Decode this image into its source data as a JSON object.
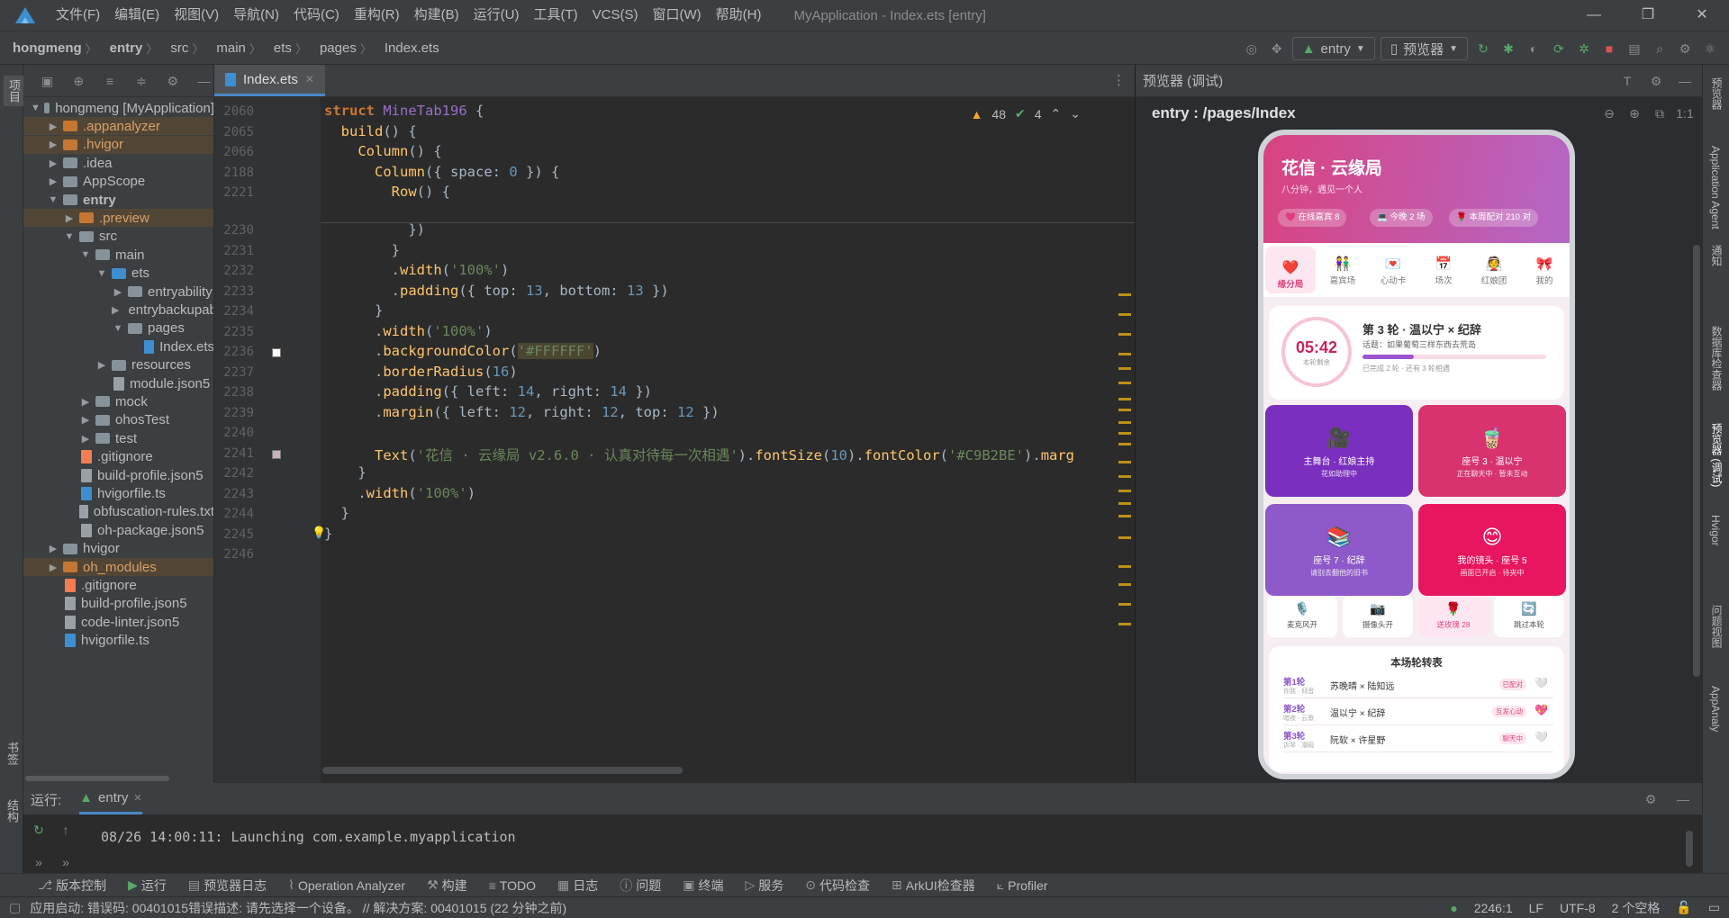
{
  "menu": [
    "文件(F)",
    "编辑(E)",
    "视图(V)",
    "导航(N)",
    "代码(C)",
    "重构(R)",
    "构建(B)",
    "运行(U)",
    "工具(T)",
    "VCS(S)",
    "窗口(W)",
    "帮助(H)"
  ],
  "window_title": "MyApplication - Index.ets [entry]",
  "breadcrumb": [
    "hongmeng",
    "entry",
    "src",
    "main",
    "ets",
    "pages",
    "Index.ets"
  ],
  "run_config": "entry",
  "device_combo": "预览器",
  "left_tabs": [
    "项目",
    "书签",
    "结构"
  ],
  "tree": [
    {
      "label": "hongmeng [MyApplication]",
      "depth": 0,
      "open": true,
      "kind": "fold-b"
    },
    {
      "label": ".appanalyzer",
      "depth": 1,
      "kind": "fold-o",
      "closed": true,
      "hl": true
    },
    {
      "label": ".hvigor",
      "depth": 1,
      "kind": "fold-o",
      "closed": true,
      "hl": true
    },
    {
      "label": ".idea",
      "depth": 1,
      "kind": "fold-b",
      "closed": true
    },
    {
      "label": "AppScope",
      "depth": 1,
      "kind": "fold-b",
      "closed": true
    },
    {
      "label": "entry",
      "depth": 1,
      "kind": "fold-b",
      "open": true,
      "bold": true
    },
    {
      "label": ".preview",
      "depth": 2,
      "kind": "fold-o",
      "closed": true,
      "hl": true
    },
    {
      "label": "src",
      "depth": 2,
      "kind": "fold-b",
      "open": true
    },
    {
      "label": "main",
      "depth": 3,
      "kind": "fold-b",
      "open": true
    },
    {
      "label": "ets",
      "depth": 4,
      "kind": "fold-bl",
      "open": true
    },
    {
      "label": "entryability",
      "depth": 5,
      "kind": "fold-b",
      "closed": true
    },
    {
      "label": "entrybackupability",
      "depth": 5,
      "kind": "fold-b",
      "closed": true
    },
    {
      "label": "pages",
      "depth": 5,
      "kind": "fold-b",
      "open": true
    },
    {
      "label": "Index.ets",
      "depth": 6,
      "kind": "file-ts"
    },
    {
      "label": "resources",
      "depth": 4,
      "kind": "fold-b",
      "closed": true
    },
    {
      "label": "module.json5",
      "depth": 4,
      "kind": "file"
    },
    {
      "label": "mock",
      "depth": 3,
      "kind": "fold-b",
      "closed": true
    },
    {
      "label": "ohosTest",
      "depth": 3,
      "kind": "fold-b",
      "closed": true
    },
    {
      "label": "test",
      "depth": 3,
      "kind": "fold-b",
      "closed": true
    },
    {
      "label": ".gitignore",
      "depth": 2,
      "kind": "file-gi"
    },
    {
      "label": "build-profile.json5",
      "depth": 2,
      "kind": "file"
    },
    {
      "label": "hvigorfile.ts",
      "depth": 2,
      "kind": "file-ts"
    },
    {
      "label": "obfuscation-rules.txt",
      "depth": 2,
      "kind": "file"
    },
    {
      "label": "oh-package.json5",
      "depth": 2,
      "kind": "file"
    },
    {
      "label": "hvigor",
      "depth": 1,
      "kind": "fold-b",
      "closed": true
    },
    {
      "label": "oh_modules",
      "depth": 1,
      "kind": "fold-o",
      "closed": true,
      "hl": true
    },
    {
      "label": ".gitignore",
      "depth": 1,
      "kind": "file-gi"
    },
    {
      "label": "build-profile.json5",
      "depth": 1,
      "kind": "file"
    },
    {
      "label": "code-linter.json5",
      "depth": 1,
      "kind": "file"
    },
    {
      "label": "hvigorfile.ts",
      "depth": 1,
      "kind": "file-ts"
    }
  ],
  "editor_tab": "Index.ets",
  "inspections": {
    "warnings": "48",
    "ok": "4"
  },
  "sticky_lines": [
    {
      "n": "2060",
      "html": "<span class='kw'>struct</span> <span class='cls'>MineTab196</span> {"
    },
    {
      "n": "2065",
      "html": "  <span class='fn'>build</span>() {"
    },
    {
      "n": "2066",
      "html": "    <span class='fn'>Column</span>() {"
    },
    {
      "n": "2188",
      "html": "      <span class='fn'>Column</span>({ space: <span class='num'>0</span> }) {"
    },
    {
      "n": "2221",
      "html": "        <span class='fn'>Row</span>() {"
    }
  ],
  "code_lines": [
    {
      "n": "2230",
      "html": "          })"
    },
    {
      "n": "2231",
      "html": "        }"
    },
    {
      "n": "2232",
      "html": "        .<span class='fn'>width</span>(<span class='str'>'100%'</span>)"
    },
    {
      "n": "2233",
      "html": "        .<span class='fn'>padding</span>({ top: <span class='num'>13</span>, bottom: <span class='num'>13</span> })"
    },
    {
      "n": "2234",
      "html": "      }"
    },
    {
      "n": "2235",
      "html": "      .<span class='fn'>width</span>(<span class='str'>'100%'</span>)"
    },
    {
      "n": "2236",
      "html": "      .<span class='fn'>backgroundColor</span>(<span class='str' style='background:#4b4632'>'#FFFFFF'</span>)"
    },
    {
      "n": "2237",
      "html": "      .<span class='fn'>borderRadius</span>(<span class='num'>16</span>)"
    },
    {
      "n": "2238",
      "html": "      .<span class='fn'>padding</span>({ left: <span class='num'>14</span>, right: <span class='num'>14</span> })"
    },
    {
      "n": "2239",
      "html": "      .<span class='fn'>margin</span>({ left: <span class='num'>12</span>, right: <span class='num'>12</span>, top: <span class='num'>12</span> })"
    },
    {
      "n": "2240",
      "html": ""
    },
    {
      "n": "2241",
      "html": "      <span class='fn'>Text</span>(<span class='str'>'花信 · 云缘局 v2.6.0 · 认真对待每一次相遇'</span>).<span class='fn'>fontSize</span>(<span class='num'>10</span>).<span class='fn'>fontColor</span>(<span class='str'>'#C9B2BE'</span>).<span class='fn'>marg</span>"
    },
    {
      "n": "2242",
      "html": "    }"
    },
    {
      "n": "2243",
      "html": "    .<span class='fn'>width</span>(<span class='str'>'100%'</span>)"
    },
    {
      "n": "2244",
      "html": "  }"
    },
    {
      "n": "2245",
      "html": "}"
    },
    {
      "n": "2246",
      "html": ""
    }
  ],
  "preview": {
    "title": "预览器 (调试)",
    "route": "entry : /pages/Index"
  },
  "phone": {
    "title": "花信 · 云缘局",
    "subtitle": "八分钟，遇见一个人",
    "chips": [
      "在线嘉宾 8",
      "今晚 2 场",
      "本周配对 210 对"
    ],
    "nav": [
      {
        "e": "❤️",
        "t": "缘分局",
        "on": true
      },
      {
        "e": "👫",
        "t": "嘉宾场"
      },
      {
        "e": "💌",
        "t": "心动卡"
      },
      {
        "e": "📅",
        "t": "场次"
      },
      {
        "e": "👰",
        "t": "红娘团"
      },
      {
        "e": "🎀",
        "t": "我的"
      }
    ],
    "timer": "05:42",
    "timer_label": "本轮剩余",
    "round_title": "第 3 轮 · 温以宁 × 纪辞",
    "round_topic": "话题：如果葡萄三样东西去荒岛",
    "round_progress": 0.28,
    "round_note": "已完成 2 轮 · 还有 3 轮相遇",
    "tiles": [
      {
        "e": "🎥",
        "t": "主舞台 · 红娘主持",
        "s": "花如助理中",
        "c": "#7a2fbf"
      },
      {
        "e": "🧋",
        "t": "座号 3 · 温以宁",
        "s": "正在聊天中 · 暂未互动",
        "c": "#d8336e"
      },
      {
        "e": "📚",
        "t": "座号 7 · 纪辞",
        "s": "请别去翻他的旧书",
        "c": "#8e59c9"
      },
      {
        "e": "😊",
        "t": "我的镜头 · 座号 5",
        "s": "画面已开启 · 待夹中",
        "c": "#e8165e"
      }
    ],
    "minis": [
      {
        "e": "🎙️",
        "t": "麦克风开"
      },
      {
        "e": "📷",
        "t": "摄像头开"
      },
      {
        "e": "🌹",
        "t": "送玫瑰 28",
        "pink": true
      },
      {
        "e": "🔄",
        "t": "跳过本轮"
      }
    ],
    "table_title": "本场轮转表",
    "rows": [
      {
        "r": "第1轮",
        "s": "你我 · 倾音",
        "p": "苏晚晴 × 陆知远",
        "st": "已配对",
        "h": "🤍"
      },
      {
        "r": "第2轮",
        "s": "暗夜 · 云歌",
        "p": "温以宁 × 纪辞",
        "st": "互发心动",
        "h": "💖"
      },
      {
        "r": "第3轮",
        "s": "诉琴 · 潮砚",
        "p": "阮软 × 许星野",
        "st": "聊天中",
        "h": "🤍"
      }
    ]
  },
  "right_tabs": [
    "预览器",
    "Application Agent",
    "通知",
    "数据库检查器",
    "预览器 (调试)",
    "Hvigor",
    "问题视图",
    "AppAnaly"
  ],
  "run": {
    "label": "运行:",
    "config": "entry",
    "log": "08/26 14:00:11: Launching com.example.myapplication"
  },
  "bottom_tools": [
    "版本控制",
    "运行",
    "预览器日志",
    "Operation Analyzer",
    "构建",
    "TODO",
    "日志",
    "问题",
    "终端",
    "服务",
    "代码检查",
    "ArkUI检查器",
    "Profiler"
  ],
  "status": {
    "msg": "应用启动: 错误码: 00401015错误描述: 请先选择一个设备。 // 解决方案: 00401015 (22 分钟之前)",
    "pos": "2246:1",
    "lf": "LF",
    "enc": "UTF-8",
    "indent": "2 个空格"
  }
}
